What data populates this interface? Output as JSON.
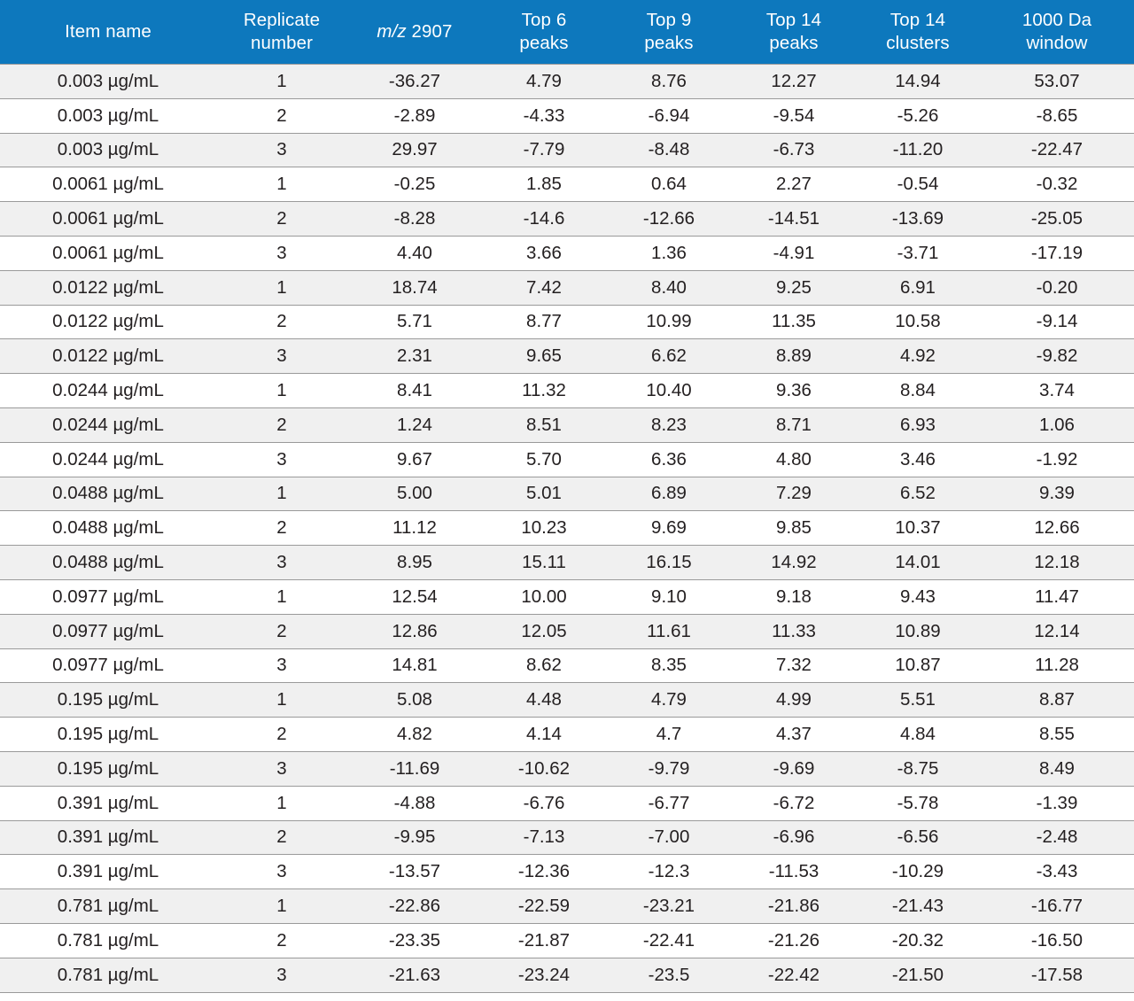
{
  "table": {
    "columns": [
      {
        "key": "item_name",
        "lines": [
          "Item name"
        ],
        "italic_first_token": false
      },
      {
        "key": "replicate",
        "lines": [
          "Replicate",
          "number"
        ],
        "italic_first_token": false
      },
      {
        "key": "mz_2907",
        "lines": [
          "m/z 2907"
        ],
        "italic_first_token": true
      },
      {
        "key": "top_6_peaks",
        "lines": [
          "Top 6",
          "peaks"
        ],
        "italic_first_token": false
      },
      {
        "key": "top_9_peaks",
        "lines": [
          "Top 9",
          "peaks"
        ],
        "italic_first_token": false
      },
      {
        "key": "top_14_peaks",
        "lines": [
          "Top 14",
          "peaks"
        ],
        "italic_first_token": false
      },
      {
        "key": "top_14_clusters",
        "lines": [
          "Top 14",
          "clusters"
        ],
        "italic_first_token": false
      },
      {
        "key": "window_1000_da",
        "lines": [
          "1000 Da",
          "window"
        ],
        "italic_first_token": false
      }
    ],
    "header_italic_token": "m/z",
    "header_italic_rest": " 2907",
    "rows": [
      [
        "0.003 µg/mL",
        "1",
        "-36.27",
        "4.79",
        "8.76",
        "12.27",
        "14.94",
        "53.07"
      ],
      [
        "0.003 µg/mL",
        "2",
        "-2.89",
        "-4.33",
        "-6.94",
        "-9.54",
        "-5.26",
        "-8.65"
      ],
      [
        "0.003 µg/mL",
        "3",
        "29.97",
        "-7.79",
        "-8.48",
        "-6.73",
        "-11.20",
        "-22.47"
      ],
      [
        "0.0061 µg/mL",
        "1",
        "-0.25",
        "1.85",
        "0.64",
        "2.27",
        "-0.54",
        "-0.32"
      ],
      [
        "0.0061 µg/mL",
        "2",
        "-8.28",
        "-14.6",
        "-12.66",
        "-14.51",
        "-13.69",
        "-25.05"
      ],
      [
        "0.0061 µg/mL",
        "3",
        "4.40",
        "3.66",
        "1.36",
        "-4.91",
        "-3.71",
        "-17.19"
      ],
      [
        "0.0122 µg/mL",
        "1",
        "18.74",
        "7.42",
        "8.40",
        "9.25",
        "6.91",
        "-0.20"
      ],
      [
        "0.0122 µg/mL",
        "2",
        "5.71",
        "8.77",
        "10.99",
        "11.35",
        "10.58",
        "-9.14"
      ],
      [
        "0.0122 µg/mL",
        "3",
        "2.31",
        "9.65",
        "6.62",
        "8.89",
        "4.92",
        "-9.82"
      ],
      [
        "0.0244 µg/mL",
        "1",
        "8.41",
        "11.32",
        "10.40",
        "9.36",
        "8.84",
        "3.74"
      ],
      [
        "0.0244 µg/mL",
        "2",
        "1.24",
        "8.51",
        "8.23",
        "8.71",
        "6.93",
        "1.06"
      ],
      [
        "0.0244 µg/mL",
        "3",
        "9.67",
        "5.70",
        "6.36",
        "4.80",
        "3.46",
        "-1.92"
      ],
      [
        "0.0488 µg/mL",
        "1",
        "5.00",
        "5.01",
        "6.89",
        "7.29",
        "6.52",
        "9.39"
      ],
      [
        "0.0488 µg/mL",
        "2",
        "11.12",
        "10.23",
        "9.69",
        "9.85",
        "10.37",
        "12.66"
      ],
      [
        "0.0488 µg/mL",
        "3",
        "8.95",
        "15.11",
        "16.15",
        "14.92",
        "14.01",
        "12.18"
      ],
      [
        "0.0977 µg/mL",
        "1",
        "12.54",
        "10.00",
        "9.10",
        "9.18",
        "9.43",
        "11.47"
      ],
      [
        "0.0977 µg/mL",
        "2",
        "12.86",
        "12.05",
        "11.61",
        "11.33",
        "10.89",
        "12.14"
      ],
      [
        "0.0977 µg/mL",
        "3",
        "14.81",
        "8.62",
        "8.35",
        "7.32",
        "10.87",
        "11.28"
      ],
      [
        "0.195 µg/mL",
        "1",
        "5.08",
        "4.48",
        "4.79",
        "4.99",
        "5.51",
        "8.87"
      ],
      [
        "0.195 µg/mL",
        "2",
        "4.82",
        "4.14",
        "4.7",
        "4.37",
        "4.84",
        "8.55"
      ],
      [
        "0.195 µg/mL",
        "3",
        "-11.69",
        "-10.62",
        "-9.79",
        "-9.69",
        "-8.75",
        "8.49"
      ],
      [
        "0.391 µg/mL",
        "1",
        "-4.88",
        "-6.76",
        "-6.77",
        "-6.72",
        "-5.78",
        "-1.39"
      ],
      [
        "0.391 µg/mL",
        "2",
        "-9.95",
        "-7.13",
        "-7.00",
        "-6.96",
        "-6.56",
        "-2.48"
      ],
      [
        "0.391 µg/mL",
        "3",
        "-13.57",
        "-12.36",
        "-12.3",
        "-11.53",
        "-10.29",
        "-3.43"
      ],
      [
        "0.781 µg/mL",
        "1",
        "-22.86",
        "-22.59",
        "-23.21",
        "-21.86",
        "-21.43",
        "-16.77"
      ],
      [
        "0.781 µg/mL",
        "2",
        "-23.35",
        "-21.87",
        "-22.41",
        "-21.26",
        "-20.32",
        "-16.50"
      ],
      [
        "0.781 µg/mL",
        "3",
        "-21.63",
        "-23.24",
        "-23.5",
        "-22.42",
        "-21.50",
        "-17.58"
      ]
    ]
  },
  "colors": {
    "header_background": "#0d78bd",
    "header_text": "#ffffff",
    "row_shaded_background": "#f0f0f0",
    "row_plain_background": "#ffffff",
    "row_border": "#9a9a9a",
    "body_text": "#231f20"
  }
}
